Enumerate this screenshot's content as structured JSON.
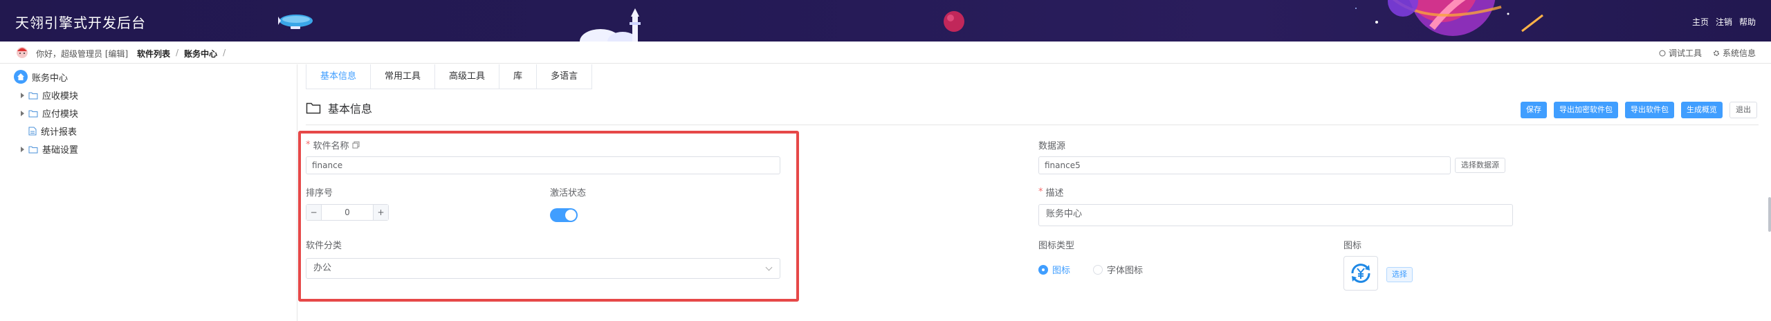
{
  "header": {
    "title": "天翎引擎式开发后台",
    "links": [
      "主页",
      "注销",
      "帮助"
    ]
  },
  "crumbbar": {
    "greeting": "你好，超级管理员 [编辑]",
    "crumbs": [
      "软件列表",
      "账务中心"
    ],
    "separator": "/",
    "tools": [
      "调试工具",
      "系统信息"
    ]
  },
  "sidebar": {
    "root": "账务中心",
    "items": [
      {
        "label": "应收模块",
        "icon": "folder-icon",
        "expandable": true
      },
      {
        "label": "应付模块",
        "icon": "folder-icon",
        "expandable": true
      },
      {
        "label": "统计报表",
        "icon": "file-icon",
        "expandable": false
      },
      {
        "label": "基础设置",
        "icon": "folder-icon",
        "expandable": true
      }
    ]
  },
  "tabs": [
    "基本信息",
    "常用工具",
    "高级工具",
    "库",
    "多语言"
  ],
  "section": {
    "title": "基本信息"
  },
  "actions": [
    "保存",
    "导出加密软件包",
    "导出软件包",
    "生成概览",
    "退出"
  ],
  "form": {
    "software_name": {
      "label": "软件名称",
      "value": "finance"
    },
    "sort_order": {
      "label": "排序号",
      "value": "0",
      "minus": "−",
      "plus": "+"
    },
    "active_status": {
      "label": "激活状态",
      "on": true
    },
    "category": {
      "label": "软件分类",
      "value": "办公"
    },
    "datasource": {
      "label": "数据源",
      "value": "finance5",
      "button": "选择数据源"
    },
    "description": {
      "label": "描述",
      "value": "账务中心"
    },
    "icon_type": {
      "label": "图标类型",
      "options": [
        "图标",
        "字体图标"
      ],
      "selected": "图标"
    },
    "icon": {
      "label": "图标",
      "button": "选择"
    }
  },
  "colors": {
    "primary": "#409eff",
    "header_bg": "#22184f",
    "highlight": "#e64848"
  }
}
